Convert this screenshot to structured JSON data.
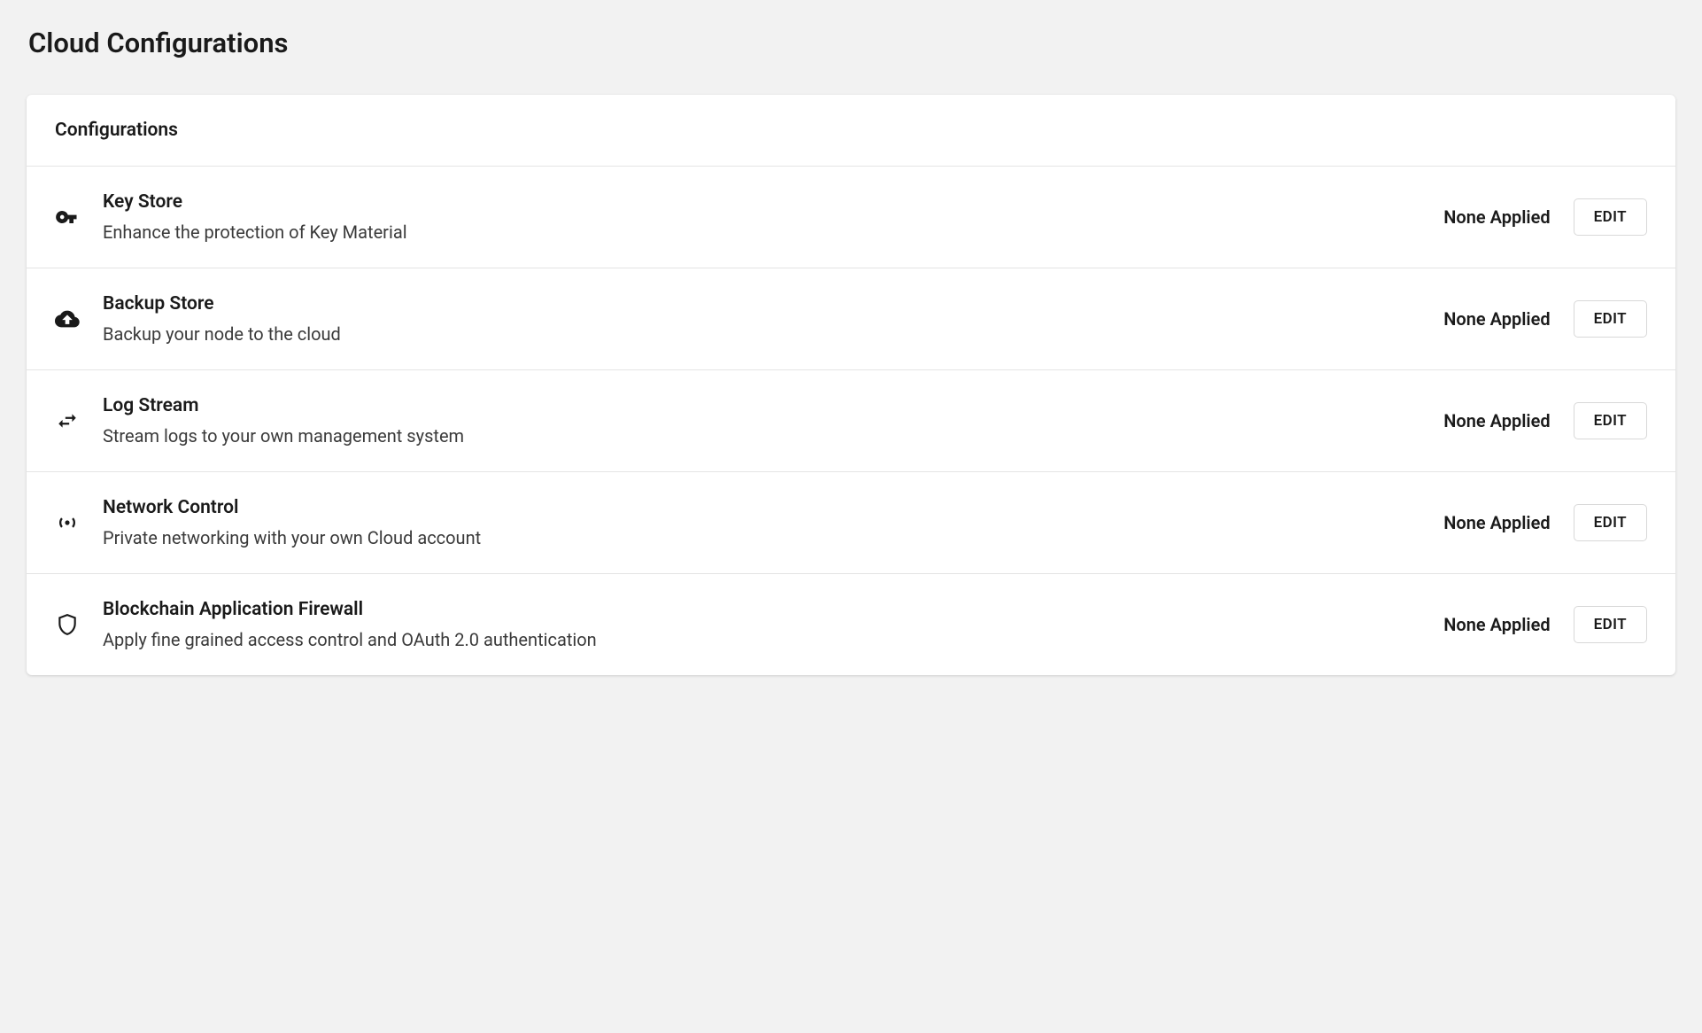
{
  "page": {
    "title": "Cloud Configurations"
  },
  "card": {
    "header": "Configurations"
  },
  "rows": [
    {
      "icon": "key-icon",
      "title": "Key Store",
      "description": "Enhance the protection of Key Material",
      "status": "None Applied",
      "action": "EDIT"
    },
    {
      "icon": "cloud-upload-icon",
      "title": "Backup Store",
      "description": "Backup your node to the cloud",
      "status": "None Applied",
      "action": "EDIT"
    },
    {
      "icon": "swap-icon",
      "title": "Log Stream",
      "description": "Stream logs to your own management system",
      "status": "None Applied",
      "action": "EDIT"
    },
    {
      "icon": "network-icon",
      "title": "Network Control",
      "description": "Private networking with your own Cloud account",
      "status": "None Applied",
      "action": "EDIT"
    },
    {
      "icon": "shield-icon",
      "title": "Blockchain Application Firewall",
      "description": "Apply fine grained access control and OAuth 2.0 authentication",
      "status": "None Applied",
      "action": "EDIT"
    }
  ]
}
